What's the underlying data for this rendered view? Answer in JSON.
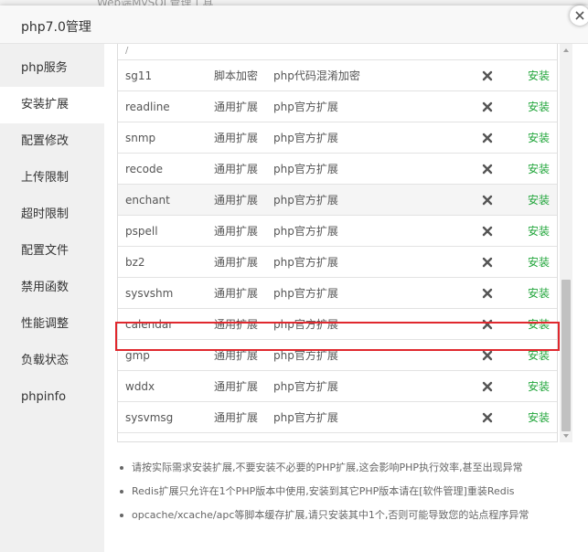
{
  "background": {
    "strip_text": "Web端MySQL管理工具"
  },
  "dialog": {
    "title": "php7.0管理"
  },
  "sidebar": {
    "items": [
      {
        "label": "php服务",
        "active": false
      },
      {
        "label": "安装扩展",
        "active": true
      },
      {
        "label": "配置修改",
        "active": false
      },
      {
        "label": "上传限制",
        "active": false
      },
      {
        "label": "超时限制",
        "active": false
      },
      {
        "label": "配置文件",
        "active": false
      },
      {
        "label": "禁用函数",
        "active": false
      },
      {
        "label": "性能调整",
        "active": false
      },
      {
        "label": "负载状态",
        "active": false
      },
      {
        "label": "phpinfo",
        "active": false
      }
    ]
  },
  "table": {
    "partial_row_text": "/",
    "rows": [
      {
        "name": "sg11",
        "type": "脚本加密",
        "desc": "php代码混淆加密",
        "status_icon": "x-icon",
        "action": "安装"
      },
      {
        "name": "readline",
        "type": "通用扩展",
        "desc": "php官方扩展",
        "status_icon": "x-icon",
        "action": "安装"
      },
      {
        "name": "snmp",
        "type": "通用扩展",
        "desc": "php官方扩展",
        "status_icon": "x-icon",
        "action": "安装"
      },
      {
        "name": "recode",
        "type": "通用扩展",
        "desc": "php官方扩展",
        "status_icon": "x-icon",
        "action": "安装"
      },
      {
        "name": "enchant",
        "type": "通用扩展",
        "desc": "php官方扩展",
        "status_icon": "x-icon",
        "action": "安装"
      },
      {
        "name": "pspell",
        "type": "通用扩展",
        "desc": "php官方扩展",
        "status_icon": "x-icon",
        "action": "安装"
      },
      {
        "name": "bz2",
        "type": "通用扩展",
        "desc": "php官方扩展",
        "status_icon": "x-icon",
        "action": "安装"
      },
      {
        "name": "sysvshm",
        "type": "通用扩展",
        "desc": "php官方扩展",
        "status_icon": "x-icon",
        "action": "安装"
      },
      {
        "name": "calendar",
        "type": "通用扩展",
        "desc": "php官方扩展",
        "status_icon": "x-icon",
        "action": "安装"
      },
      {
        "name": "gmp",
        "type": "通用扩展",
        "desc": "php官方扩展",
        "status_icon": "x-icon",
        "action": "安装"
      },
      {
        "name": "wddx",
        "type": "通用扩展",
        "desc": "php官方扩展",
        "status_icon": "x-icon",
        "action": "安装"
      },
      {
        "name": "sysvmsg",
        "type": "通用扩展",
        "desc": "php官方扩展",
        "status_icon": "x-icon",
        "action": "安装"
      }
    ]
  },
  "notes": [
    "请按实际需求安装扩展,不要安装不必要的PHP扩展,这会影响PHP执行效率,甚至出现异常",
    "Redis扩展只允许在1个PHP版本中使用,安装到其它PHP版本请在[软件管理]重装Redis",
    "opcache/xcache/apc等脚本缓存扩展,请只安装其中1个,否则可能导致您的站点程序异常"
  ],
  "colors": {
    "action_green": "#20a53a",
    "highlight_red": "#e0282e",
    "sidebar_bg": "#f0f0f0"
  }
}
